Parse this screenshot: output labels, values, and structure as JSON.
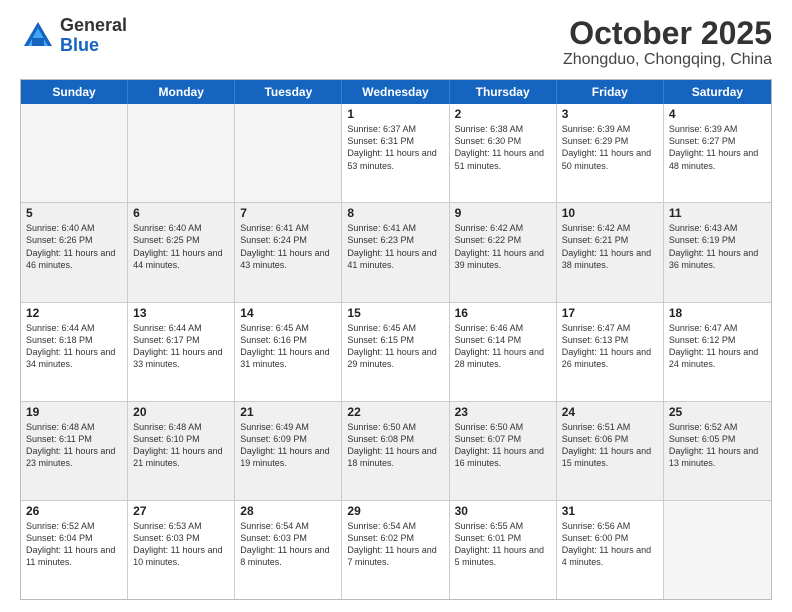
{
  "header": {
    "logo_general": "General",
    "logo_blue": "Blue",
    "month": "October 2025",
    "location": "Zhongduo, Chongqing, China"
  },
  "days_of_week": [
    "Sunday",
    "Monday",
    "Tuesday",
    "Wednesday",
    "Thursday",
    "Friday",
    "Saturday"
  ],
  "weeks": [
    [
      {
        "day": "",
        "info": ""
      },
      {
        "day": "",
        "info": ""
      },
      {
        "day": "",
        "info": ""
      },
      {
        "day": "1",
        "info": "Sunrise: 6:37 AM\nSunset: 6:31 PM\nDaylight: 11 hours and 53 minutes."
      },
      {
        "day": "2",
        "info": "Sunrise: 6:38 AM\nSunset: 6:30 PM\nDaylight: 11 hours and 51 minutes."
      },
      {
        "day": "3",
        "info": "Sunrise: 6:39 AM\nSunset: 6:29 PM\nDaylight: 11 hours and 50 minutes."
      },
      {
        "day": "4",
        "info": "Sunrise: 6:39 AM\nSunset: 6:27 PM\nDaylight: 11 hours and 48 minutes."
      }
    ],
    [
      {
        "day": "5",
        "info": "Sunrise: 6:40 AM\nSunset: 6:26 PM\nDaylight: 11 hours and 46 minutes."
      },
      {
        "day": "6",
        "info": "Sunrise: 6:40 AM\nSunset: 6:25 PM\nDaylight: 11 hours and 44 minutes."
      },
      {
        "day": "7",
        "info": "Sunrise: 6:41 AM\nSunset: 6:24 PM\nDaylight: 11 hours and 43 minutes."
      },
      {
        "day": "8",
        "info": "Sunrise: 6:41 AM\nSunset: 6:23 PM\nDaylight: 11 hours and 41 minutes."
      },
      {
        "day": "9",
        "info": "Sunrise: 6:42 AM\nSunset: 6:22 PM\nDaylight: 11 hours and 39 minutes."
      },
      {
        "day": "10",
        "info": "Sunrise: 6:42 AM\nSunset: 6:21 PM\nDaylight: 11 hours and 38 minutes."
      },
      {
        "day": "11",
        "info": "Sunrise: 6:43 AM\nSunset: 6:19 PM\nDaylight: 11 hours and 36 minutes."
      }
    ],
    [
      {
        "day": "12",
        "info": "Sunrise: 6:44 AM\nSunset: 6:18 PM\nDaylight: 11 hours and 34 minutes."
      },
      {
        "day": "13",
        "info": "Sunrise: 6:44 AM\nSunset: 6:17 PM\nDaylight: 11 hours and 33 minutes."
      },
      {
        "day": "14",
        "info": "Sunrise: 6:45 AM\nSunset: 6:16 PM\nDaylight: 11 hours and 31 minutes."
      },
      {
        "day": "15",
        "info": "Sunrise: 6:45 AM\nSunset: 6:15 PM\nDaylight: 11 hours and 29 minutes."
      },
      {
        "day": "16",
        "info": "Sunrise: 6:46 AM\nSunset: 6:14 PM\nDaylight: 11 hours and 28 minutes."
      },
      {
        "day": "17",
        "info": "Sunrise: 6:47 AM\nSunset: 6:13 PM\nDaylight: 11 hours and 26 minutes."
      },
      {
        "day": "18",
        "info": "Sunrise: 6:47 AM\nSunset: 6:12 PM\nDaylight: 11 hours and 24 minutes."
      }
    ],
    [
      {
        "day": "19",
        "info": "Sunrise: 6:48 AM\nSunset: 6:11 PM\nDaylight: 11 hours and 23 minutes."
      },
      {
        "day": "20",
        "info": "Sunrise: 6:48 AM\nSunset: 6:10 PM\nDaylight: 11 hours and 21 minutes."
      },
      {
        "day": "21",
        "info": "Sunrise: 6:49 AM\nSunset: 6:09 PM\nDaylight: 11 hours and 19 minutes."
      },
      {
        "day": "22",
        "info": "Sunrise: 6:50 AM\nSunset: 6:08 PM\nDaylight: 11 hours and 18 minutes."
      },
      {
        "day": "23",
        "info": "Sunrise: 6:50 AM\nSunset: 6:07 PM\nDaylight: 11 hours and 16 minutes."
      },
      {
        "day": "24",
        "info": "Sunrise: 6:51 AM\nSunset: 6:06 PM\nDaylight: 11 hours and 15 minutes."
      },
      {
        "day": "25",
        "info": "Sunrise: 6:52 AM\nSunset: 6:05 PM\nDaylight: 11 hours and 13 minutes."
      }
    ],
    [
      {
        "day": "26",
        "info": "Sunrise: 6:52 AM\nSunset: 6:04 PM\nDaylight: 11 hours and 11 minutes."
      },
      {
        "day": "27",
        "info": "Sunrise: 6:53 AM\nSunset: 6:03 PM\nDaylight: 11 hours and 10 minutes."
      },
      {
        "day": "28",
        "info": "Sunrise: 6:54 AM\nSunset: 6:03 PM\nDaylight: 11 hours and 8 minutes."
      },
      {
        "day": "29",
        "info": "Sunrise: 6:54 AM\nSunset: 6:02 PM\nDaylight: 11 hours and 7 minutes."
      },
      {
        "day": "30",
        "info": "Sunrise: 6:55 AM\nSunset: 6:01 PM\nDaylight: 11 hours and 5 minutes."
      },
      {
        "day": "31",
        "info": "Sunrise: 6:56 AM\nSunset: 6:00 PM\nDaylight: 11 hours and 4 minutes."
      },
      {
        "day": "",
        "info": ""
      }
    ]
  ]
}
